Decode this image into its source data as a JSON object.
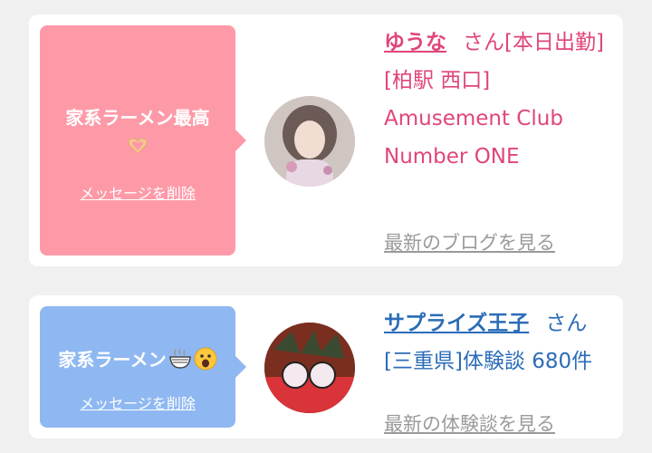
{
  "cards": [
    {
      "message": "家系ラーメン最高",
      "delete_label": "メッセージを削除",
      "name": "ゆうな",
      "honorific": "さん",
      "status": "[本日出勤]",
      "detail": "[柏駅 西口] Amusement Club Number ONE",
      "cta": "最新のブログを見る"
    },
    {
      "message": "家系ラーメン",
      "delete_label": "メッセージを削除",
      "name": "サプライズ王子",
      "honorific": "さん",
      "detail": "[三重県]体験談 680件",
      "cta": "最新の体験談を見る"
    }
  ],
  "colors": {
    "pink_bubble": "#fe9aa8",
    "blue_bubble": "#8fb8f2",
    "pink_text": "#e0457b",
    "blue_text": "#2b6cb8",
    "cta_gray": "#9a9a9a"
  },
  "icons": [
    "heart-hands-icon",
    "ramen-bowl-icon",
    "surprised-face-icon"
  ]
}
